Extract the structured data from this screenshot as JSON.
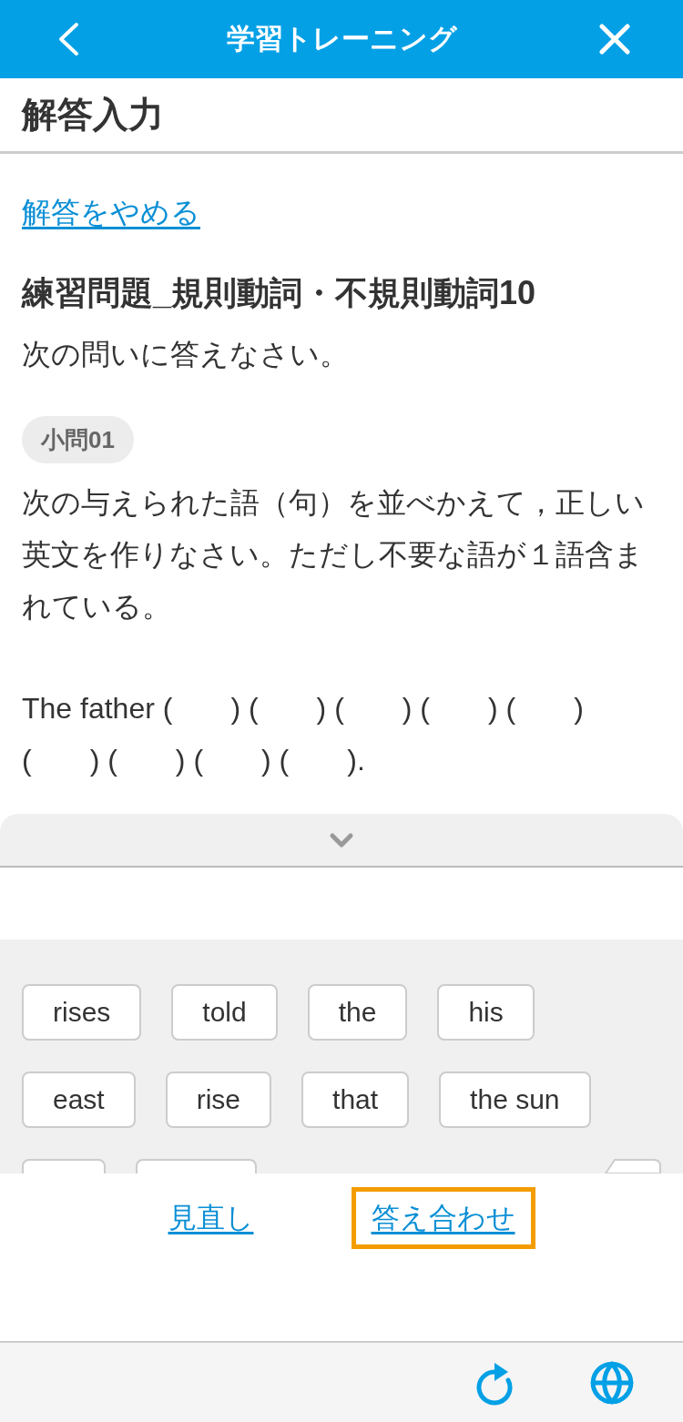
{
  "header": {
    "title": "学習トレーニング"
  },
  "page_title": "解答入力",
  "quit_link": "解答をやめる",
  "exercise": {
    "title": "練習問題_規則動詞・不規則動詞10",
    "instruction": "次の問いに答えなさい。"
  },
  "question": {
    "badge": "小問01",
    "text": "次の与えられた語（句）を並べかえて，正しい英文を作りなさい。ただし不要な語が１語含まれている。",
    "sentence": "The father (　　) (　　) (　　) (　　) (　　) (　　) (　　) (　　) (　　)."
  },
  "drawer": {
    "expanded": true
  },
  "word_chips": [
    {
      "kind": "word",
      "label": "rises"
    },
    {
      "kind": "word",
      "label": "told"
    },
    {
      "kind": "word",
      "label": "the"
    },
    {
      "kind": "word",
      "label": "his"
    },
    {
      "kind": "word",
      "label": "east"
    },
    {
      "kind": "word",
      "label": "rise"
    },
    {
      "kind": "word",
      "label": "that"
    },
    {
      "kind": "word",
      "label": "the sun"
    },
    {
      "kind": "cut_word"
    },
    {
      "kind": "cut_word"
    },
    {
      "kind": "backspace"
    }
  ],
  "footer_buttons": [
    {
      "label": "見直し",
      "highlighted": false
    },
    {
      "label": "答え合わせ",
      "highlighted": true
    }
  ]
}
